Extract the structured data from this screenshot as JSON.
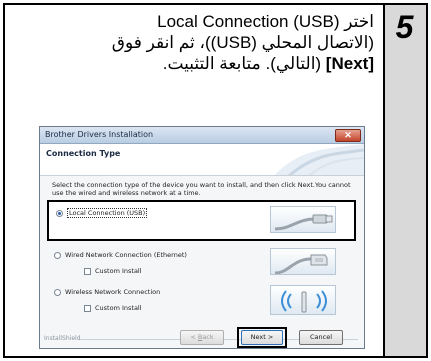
{
  "step": {
    "number": "5"
  },
  "instruction": {
    "line1": "اختر (USB) Local Connection",
    "line2": "(الاتصال المحلي (USB))، ثم انقر فوق",
    "line3_bold": "[Next]",
    "line3_rest": " (التالي). متابعة التثبيت."
  },
  "dialog": {
    "title": "Brother Drivers Installation",
    "close_label": "✕",
    "header": "Connection Type",
    "description": "Select the connection type of the device you want to install, and then click Next.You cannot use the wired and wireless network at a time.",
    "options": {
      "usb": {
        "label": "Local Connection (USB)",
        "selected": true
      },
      "wired": {
        "label": "Wired Network Connection (Ethernet)",
        "selected": false
      },
      "wired_custom": {
        "label": "Custom Install",
        "checked": false
      },
      "wireless": {
        "label": "Wireless Network Connection",
        "selected": false
      },
      "wireless_custom": {
        "label": "Custom Install",
        "checked": false
      }
    },
    "footer_brand": "InstallShield",
    "buttons": {
      "back_prefix": "< ",
      "back_accel": "B",
      "back_rest": "ack",
      "next": "Next >",
      "cancel": "Cancel"
    }
  },
  "icons": [
    "close-icon",
    "usb-cable-icon",
    "ethernet-cable-icon",
    "wireless-signal-icon"
  ],
  "colors": {
    "sidebar": "#d9d9d9",
    "highlight_border": "#000000",
    "titlebar": "#b9cde3"
  }
}
